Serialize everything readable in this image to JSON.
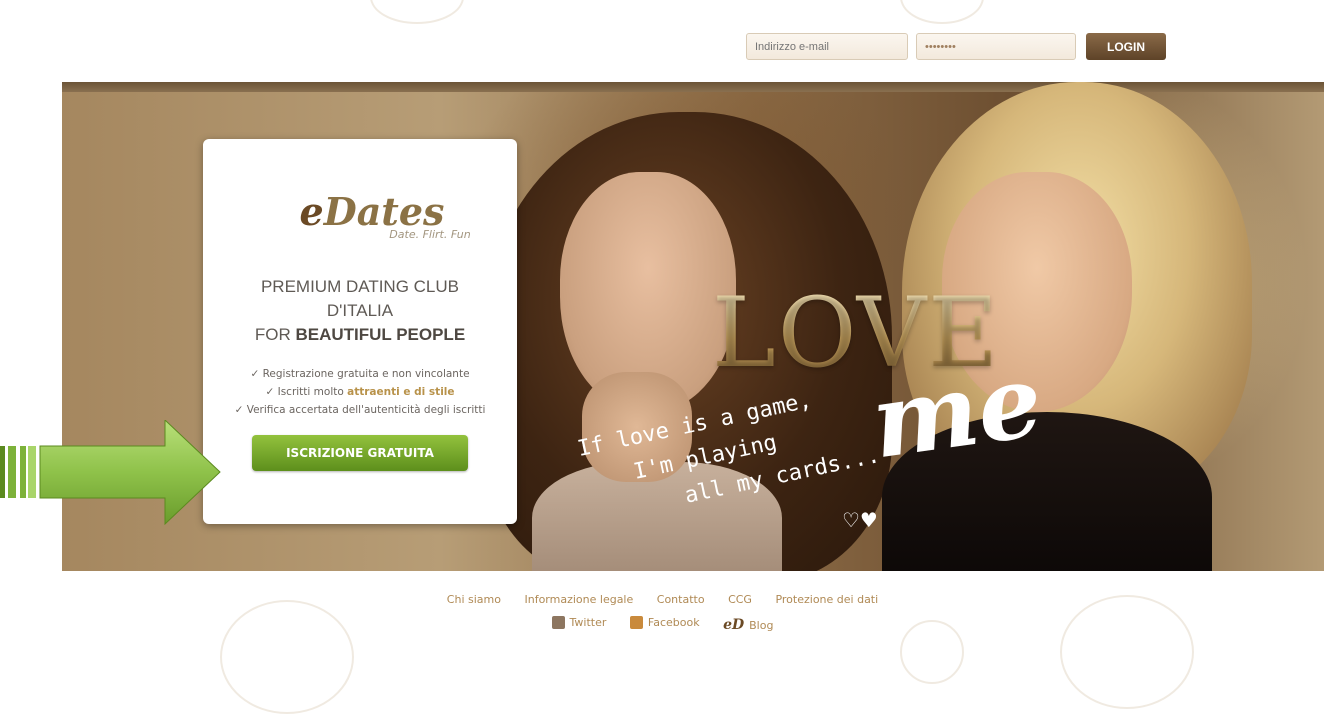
{
  "login": {
    "email_placeholder": "Indirizzo e-mail",
    "password_value": "••••••••",
    "login_label": "LOGIN"
  },
  "card": {
    "logo_e": "e",
    "logo_rest": "Dates",
    "tagline": "Date. Flirt. Fun",
    "headline_line1": "PREMIUM DATING CLUB",
    "headline_line2": "D'ITALIA",
    "headline_line3_prefix": "FOR ",
    "headline_line3_bold": "BEAUTIFUL PEOPLE",
    "benefit1": "✓ Registrazione gratuita e non vincolante",
    "benefit2_prefix": "✓ Iscritti molto ",
    "benefit2_highlight": "attraenti e di stile",
    "benefit3": "✓ Verifica accertata dell'autenticità degli iscritti",
    "cta_label": "ISCRIZIONE GRATUITA"
  },
  "hero": {
    "love_text": "LOVE",
    "me_text": "me",
    "quote_line1": "If love is a game,",
    "quote_line2": "I'm playing",
    "quote_line3": "all my cards...",
    "hearts": "♡♥"
  },
  "footer": {
    "links": [
      "Chi siamo",
      "Informazione legale",
      "Contatto",
      "CCG",
      "Protezione dei dati"
    ],
    "twitter": "Twitter",
    "facebook": "Facebook",
    "blog_logo": "eD",
    "blog": "Blog"
  }
}
